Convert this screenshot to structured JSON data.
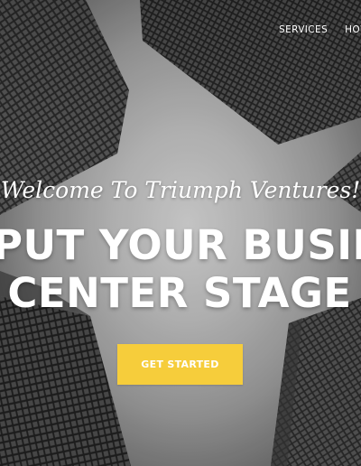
{
  "nav": {
    "items": [
      {
        "label": "SERVICES"
      },
      {
        "label": "HOW"
      }
    ]
  },
  "hero": {
    "welcome": "Welcome To Triumph Ventures!",
    "headline_line1": "PUT YOUR BUSIN",
    "headline_line2": "CENTER STAGE",
    "cta_label": "GET STARTED",
    "background_image": "skyscrapers-looking-up-icon"
  },
  "colors": {
    "cta_background": "#f6cd3b",
    "text": "#ffffff"
  }
}
